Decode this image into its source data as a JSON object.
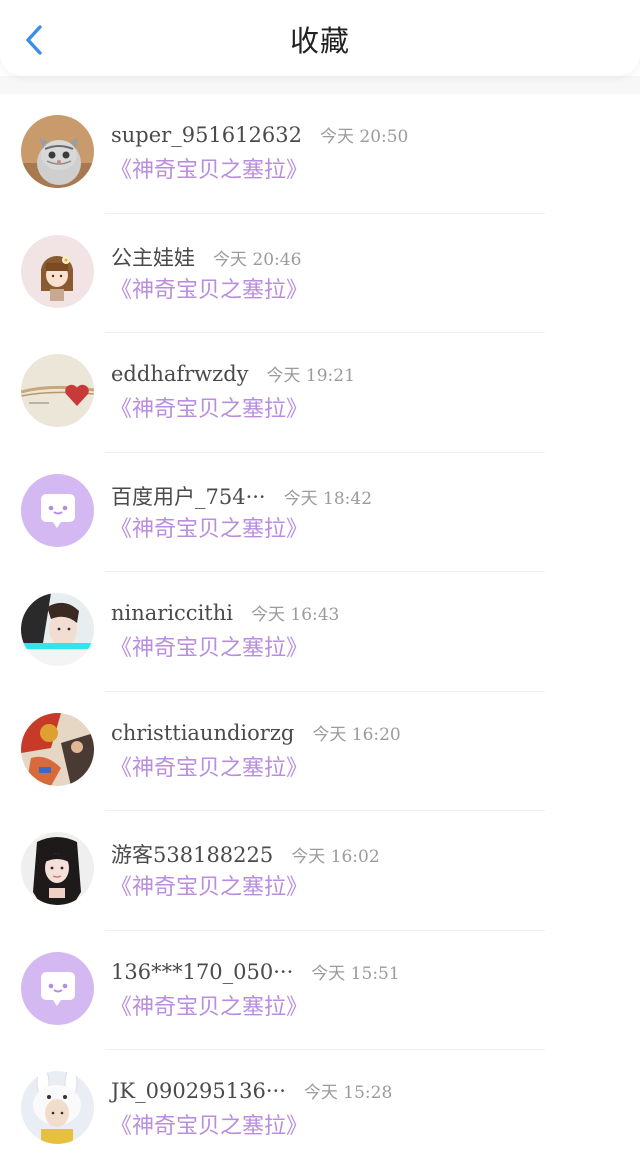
{
  "header": {
    "back_icon": "chevron-left-icon",
    "title": "收藏"
  },
  "colors": {
    "accent": "#3a8ee6",
    "link": "#b98ee0",
    "default_avatar": "#d4b8f2"
  },
  "items": [
    {
      "username": "super_951612632",
      "time": "今天 20:50",
      "link": "《神奇宝贝之塞拉》",
      "avatar": "cat-photo"
    },
    {
      "username": "公主娃娃",
      "time": "今天 20:46",
      "link": "《神奇宝贝之塞拉》",
      "avatar": "doll-illustration"
    },
    {
      "username": "eddhafrwzdy",
      "time": "今天 19:21",
      "link": "《神奇宝贝之塞拉》",
      "avatar": "heart-photo"
    },
    {
      "username": "百度用户_754···",
      "time": "今天 18:42",
      "link": "《神奇宝贝之塞拉》",
      "avatar": "default-chat-bubble-icon"
    },
    {
      "username": "ninariccithi",
      "time": "今天 16:43",
      "link": "《神奇宝贝之塞拉》",
      "avatar": "girl-photo"
    },
    {
      "username": "christtiaundiorzg",
      "time": "今天 16:20",
      "link": "《神奇宝贝之塞拉》",
      "avatar": "painting-photo"
    },
    {
      "username": "游客538188225",
      "time": "今天 16:02",
      "link": "《神奇宝贝之塞拉》",
      "avatar": "girl-selfie-photo"
    },
    {
      "username": "136***170_050···",
      "time": "今天 15:51",
      "link": "《神奇宝贝之塞拉》",
      "avatar": "default-chat-bubble-icon"
    },
    {
      "username": "JK_090295136···",
      "time": "今天 15:28",
      "link": "《神奇宝贝之塞拉》",
      "avatar": "bunny-hat-photo"
    }
  ]
}
